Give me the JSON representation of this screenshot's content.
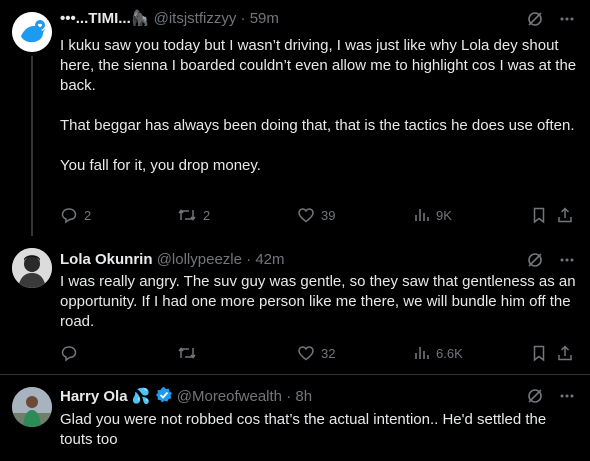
{
  "tweets": [
    {
      "display_name": "•••...TIMI...🦍",
      "handle": "@itsjstfizzyy",
      "time": "59m",
      "paragraphs": [
        "I kuku saw you today but I wasn’t driving, I was just like why Lola dey shout here, the sienna I boarded couldn’t even allow me to highlight cos I was at the back.",
        "That beggar has always been doing that, that is the tactics he does use often.",
        "You fall for it, you drop money."
      ],
      "replies": "2",
      "reposts": "2",
      "likes": "39",
      "views": "9K"
    },
    {
      "display_name": "Lola Okunrin",
      "handle": "@lollypeezle",
      "time": "42m",
      "paragraphs": [
        "I was really angry. The suv guy was gentle, so they saw that gentleness as an opportunity. If I had one more person like me there, we will bundle him off the road."
      ],
      "replies": "",
      "reposts": "",
      "likes": "32",
      "views": "6.6K"
    },
    {
      "display_name": "Harry Ola",
      "display_emoji": "💦",
      "handle": "@Moreofwealth",
      "time": "8h",
      "paragraphs": [
        "Glad you were not robbed cos that’s the actual intention.. He'd settled the touts too"
      ]
    }
  ],
  "separator": "·",
  "colors": {
    "accent": "#1d9bf0",
    "muted": "#71767b",
    "text": "#e7e9ea",
    "divider": "#2f3336"
  }
}
